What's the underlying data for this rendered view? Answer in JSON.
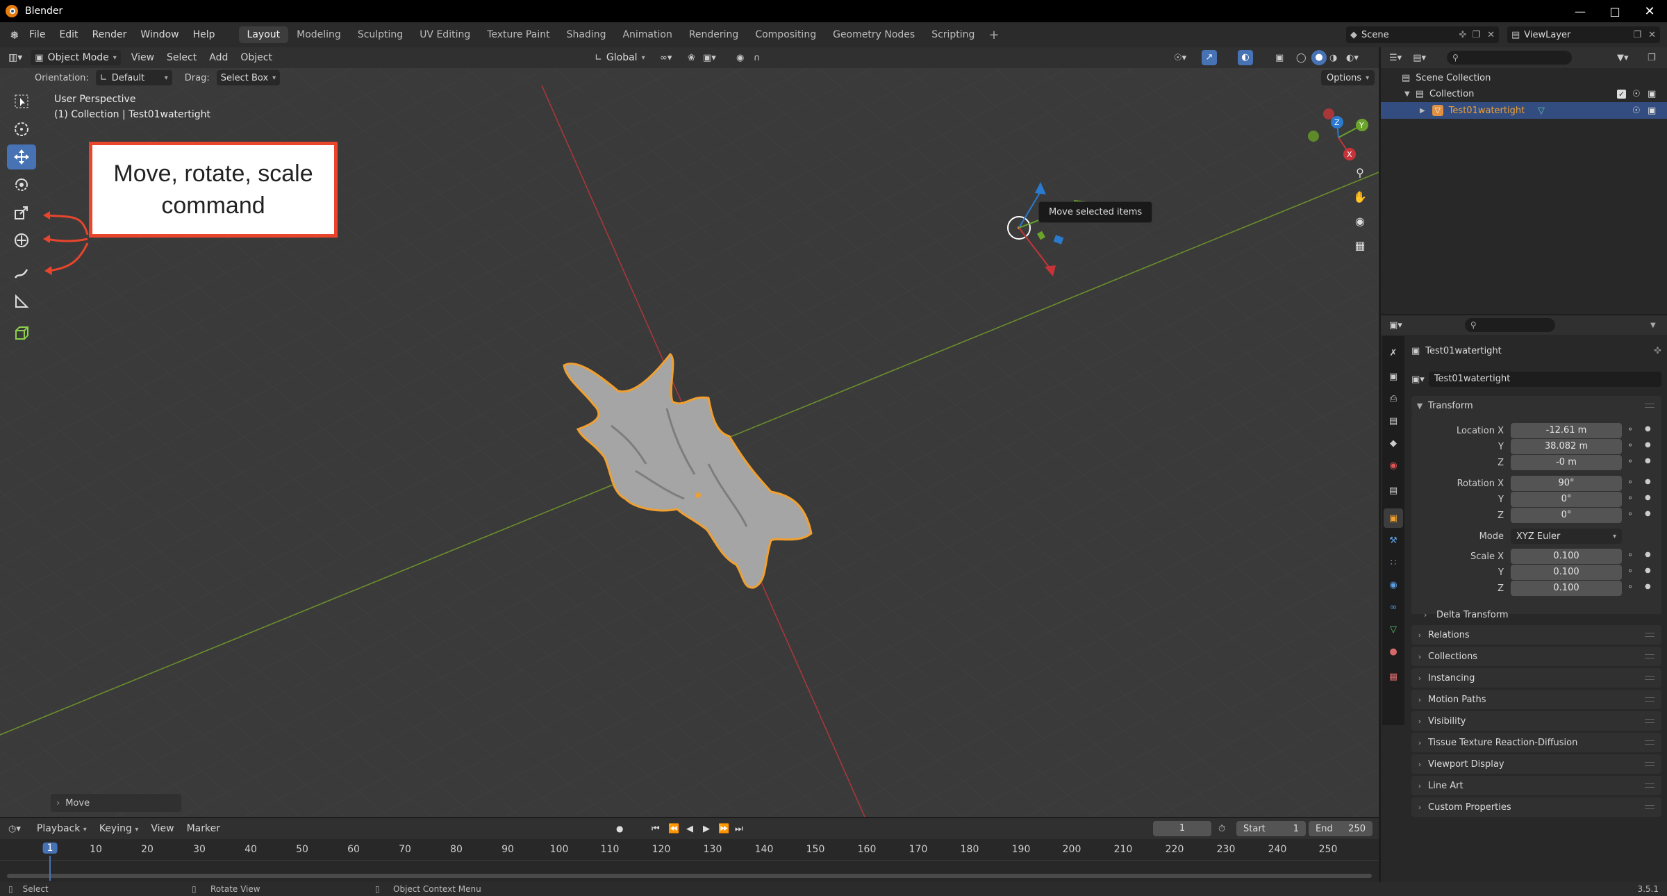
{
  "titlebar": {
    "title": "Blender"
  },
  "menu": {
    "items": [
      "File",
      "Edit",
      "Render",
      "Window",
      "Help"
    ]
  },
  "workspaces": [
    "Layout",
    "Modeling",
    "Sculpting",
    "UV Editing",
    "Texture Paint",
    "Shading",
    "Animation",
    "Rendering",
    "Compositing",
    "Geometry Nodes",
    "Scripting"
  ],
  "topright": {
    "scene": "Scene",
    "viewlayer": "ViewLayer"
  },
  "viewport_header": {
    "mode": "Object Mode",
    "menus": [
      "View",
      "Select",
      "Add",
      "Object"
    ],
    "transform_orientation": "Global"
  },
  "tool_settings": {
    "orientation_label": "Orientation:",
    "orientation_value": "Default",
    "drag_label": "Drag:",
    "drag_value": "Select Box",
    "options": "Options"
  },
  "viewport": {
    "perspective": "User Perspective",
    "collection_info": "(1) Collection | Test01watertight",
    "tooltip": "Move selected items",
    "last_op": "Move"
  },
  "annotation": {
    "text_line1": "Move, rotate, scale",
    "text_line2": "command",
    "color": "#e8452c"
  },
  "outliner": {
    "scene_collection": "Scene Collection",
    "collection": "Collection",
    "object": "Test01watertight"
  },
  "properties": {
    "object_name": "Test01watertight",
    "data_name": "Test01watertight",
    "transform_title": "Transform",
    "location_label": "Location X",
    "location": [
      "-12.61 m",
      "38.082 m",
      "-0 m"
    ],
    "rotation_label": "Rotation X",
    "rotation": [
      "90°",
      "0°",
      "0°"
    ],
    "mode_label": "Mode",
    "mode_value": "XYZ Euler",
    "scale_label": "Scale X",
    "scale": [
      "0.100",
      "0.100",
      "0.100"
    ],
    "axis_y": "Y",
    "axis_z": "Z",
    "delta_transform": "Delta Transform",
    "panels": [
      "Relations",
      "Collections",
      "Instancing",
      "Motion Paths",
      "Visibility",
      "Tissue Texture Reaction-Diffusion",
      "Viewport Display",
      "Line Art",
      "Custom Properties"
    ]
  },
  "timeline": {
    "menus": [
      "Playback",
      "Keying",
      "View",
      "Marker"
    ],
    "current_frame": "1",
    "start_label": "Start",
    "start": "1",
    "end_label": "End",
    "end": "250",
    "frames": [
      "1",
      "10",
      "20",
      "30",
      "40",
      "50",
      "60",
      "70",
      "80",
      "90",
      "100",
      "110",
      "120",
      "130",
      "140",
      "150",
      "160",
      "170",
      "180",
      "190",
      "200",
      "210",
      "220",
      "230",
      "240",
      "250"
    ]
  },
  "statusbar": {
    "select": "Select",
    "rotate": "Rotate View",
    "context": "Object Context Menu",
    "version": "3.5.1"
  },
  "colors": {
    "accent": "#4772b3",
    "selected_orange": "#f0a030",
    "x_axis": "#c6343a",
    "y_axis": "#6ba32c",
    "z_axis": "#2a7bd0"
  }
}
